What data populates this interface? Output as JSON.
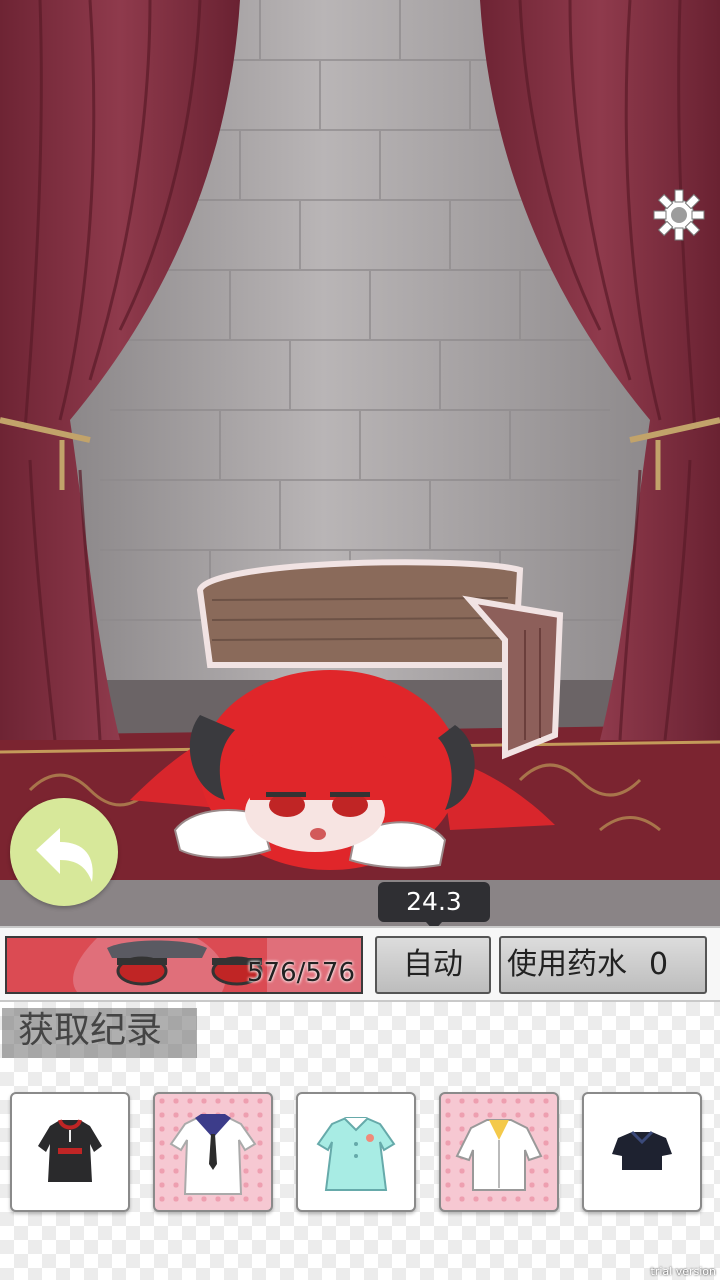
{
  "game": {
    "timer": "24.3",
    "hp": {
      "current": 576,
      "max": 576,
      "label": "576/576",
      "fraction": 1.0
    },
    "buttons": {
      "auto_label": "自动",
      "potion_label": "使用药水",
      "potion_count": "0"
    },
    "record": {
      "title": "获取纪录",
      "items": [
        {
          "name": "black-hoodie-dress",
          "rarity": "normal"
        },
        {
          "name": "sailor-uniform",
          "rarity": "rare"
        },
        {
          "name": "mint-dress",
          "rarity": "normal"
        },
        {
          "name": "white-blouse",
          "rarity": "rare"
        },
        {
          "name": "black-top",
          "rarity": "normal"
        }
      ]
    },
    "watermark": "trial version"
  },
  "icons": {
    "settings": "gear-icon",
    "back": "back-arrow-icon"
  },
  "colors": {
    "curtain": "#7e2c3d",
    "wall": "#a29ea0",
    "carpet": "#7b2430",
    "back_button": "#d7e89a",
    "hp_fill": "#e06f7a",
    "rare_bg": "#f6c8d2"
  }
}
